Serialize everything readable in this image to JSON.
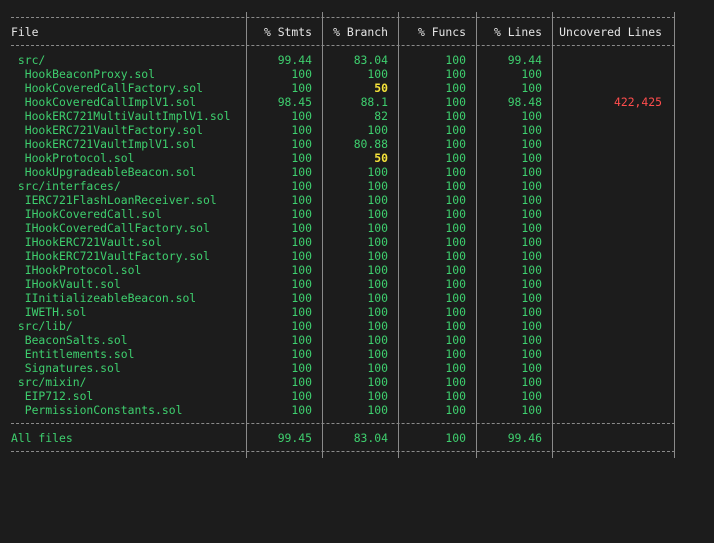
{
  "table": {
    "headers": [
      "File",
      "% Stmts",
      "% Branch",
      "% Funcs",
      "% Lines",
      "Uncovered Lines"
    ],
    "rows": [
      {
        "file": " src/",
        "stmts": "99.44",
        "branch": "83.04",
        "funcs": "100",
        "lines": "99.44",
        "uncovered": ""
      },
      {
        "file": "  HookBeaconProxy.sol",
        "stmts": "100",
        "branch": "100",
        "funcs": "100",
        "lines": "100",
        "uncovered": ""
      },
      {
        "file": "  HookCoveredCallFactory.sol",
        "stmts": "100",
        "branch": "50",
        "funcs": "100",
        "lines": "100",
        "uncovered": "",
        "branch_warn": true
      },
      {
        "file": "  HookCoveredCallImplV1.sol",
        "stmts": "98.45",
        "branch": "88.1",
        "funcs": "100",
        "lines": "98.48",
        "uncovered": "422,425"
      },
      {
        "file": "  HookERC721MultiVaultImplV1.sol",
        "stmts": "100",
        "branch": "82",
        "funcs": "100",
        "lines": "100",
        "uncovered": ""
      },
      {
        "file": "  HookERC721VaultFactory.sol",
        "stmts": "100",
        "branch": "100",
        "funcs": "100",
        "lines": "100",
        "uncovered": ""
      },
      {
        "file": "  HookERC721VaultImplV1.sol",
        "stmts": "100",
        "branch": "80.88",
        "funcs": "100",
        "lines": "100",
        "uncovered": ""
      },
      {
        "file": "  HookProtocol.sol",
        "stmts": "100",
        "branch": "50",
        "funcs": "100",
        "lines": "100",
        "uncovered": "",
        "branch_warn": true
      },
      {
        "file": "  HookUpgradeableBeacon.sol",
        "stmts": "100",
        "branch": "100",
        "funcs": "100",
        "lines": "100",
        "uncovered": ""
      },
      {
        "file": " src/interfaces/",
        "stmts": "100",
        "branch": "100",
        "funcs": "100",
        "lines": "100",
        "uncovered": ""
      },
      {
        "file": "  IERC721FlashLoanReceiver.sol",
        "stmts": "100",
        "branch": "100",
        "funcs": "100",
        "lines": "100",
        "uncovered": ""
      },
      {
        "file": "  IHookCoveredCall.sol",
        "stmts": "100",
        "branch": "100",
        "funcs": "100",
        "lines": "100",
        "uncovered": ""
      },
      {
        "file": "  IHookCoveredCallFactory.sol",
        "stmts": "100",
        "branch": "100",
        "funcs": "100",
        "lines": "100",
        "uncovered": ""
      },
      {
        "file": "  IHookERC721Vault.sol",
        "stmts": "100",
        "branch": "100",
        "funcs": "100",
        "lines": "100",
        "uncovered": ""
      },
      {
        "file": "  IHookERC721VaultFactory.sol",
        "stmts": "100",
        "branch": "100",
        "funcs": "100",
        "lines": "100",
        "uncovered": ""
      },
      {
        "file": "  IHookProtocol.sol",
        "stmts": "100",
        "branch": "100",
        "funcs": "100",
        "lines": "100",
        "uncovered": ""
      },
      {
        "file": "  IHookVault.sol",
        "stmts": "100",
        "branch": "100",
        "funcs": "100",
        "lines": "100",
        "uncovered": ""
      },
      {
        "file": "  IInitializeableBeacon.sol",
        "stmts": "100",
        "branch": "100",
        "funcs": "100",
        "lines": "100",
        "uncovered": ""
      },
      {
        "file": "  IWETH.sol",
        "stmts": "100",
        "branch": "100",
        "funcs": "100",
        "lines": "100",
        "uncovered": ""
      },
      {
        "file": " src/lib/",
        "stmts": "100",
        "branch": "100",
        "funcs": "100",
        "lines": "100",
        "uncovered": ""
      },
      {
        "file": "  BeaconSalts.sol",
        "stmts": "100",
        "branch": "100",
        "funcs": "100",
        "lines": "100",
        "uncovered": ""
      },
      {
        "file": "  Entitlements.sol",
        "stmts": "100",
        "branch": "100",
        "funcs": "100",
        "lines": "100",
        "uncovered": ""
      },
      {
        "file": "  Signatures.sol",
        "stmts": "100",
        "branch": "100",
        "funcs": "100",
        "lines": "100",
        "uncovered": ""
      },
      {
        "file": " src/mixin/",
        "stmts": "100",
        "branch": "100",
        "funcs": "100",
        "lines": "100",
        "uncovered": ""
      },
      {
        "file": "  EIP712.sol",
        "stmts": "100",
        "branch": "100",
        "funcs": "100",
        "lines": "100",
        "uncovered": ""
      },
      {
        "file": "  PermissionConstants.sol",
        "stmts": "100",
        "branch": "100",
        "funcs": "100",
        "lines": "100",
        "uncovered": ""
      }
    ],
    "summary": {
      "file": "All files",
      "stmts": "99.45",
      "branch": "83.04",
      "funcs": "100",
      "lines": "99.46",
      "uncovered": ""
    }
  },
  "colors": {
    "background": "#1c1c1c",
    "text": "#d4d4d4",
    "covered": "#3ecf6e",
    "warning": "#f5e23a",
    "uncovered": "#ff4d4d",
    "border": "#8a8a8a"
  }
}
